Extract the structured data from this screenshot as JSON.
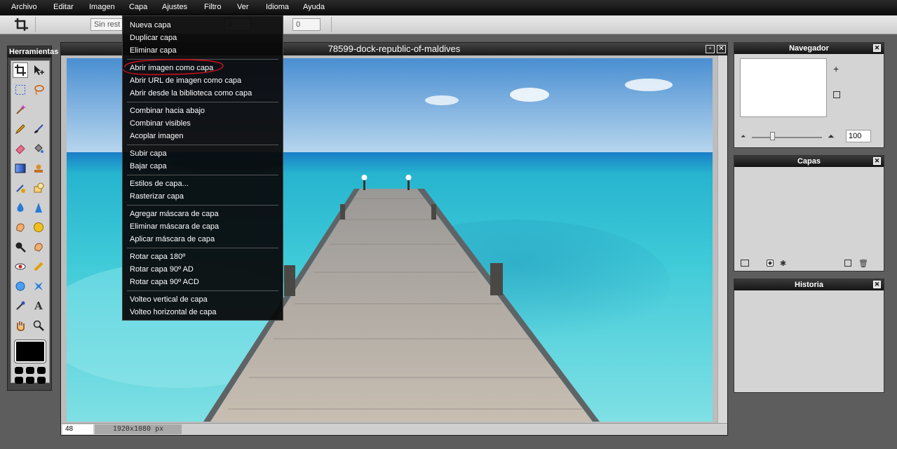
{
  "menubar": {
    "items": [
      "Archivo",
      "Editar",
      "Imagen",
      "Capa",
      "Ajustes",
      "Filtro",
      "Ver",
      "Idioma",
      "Ayuda"
    ]
  },
  "options_bar": {
    "restriction_value": "Sin rest",
    "width_value": "0",
    "height_value": "0"
  },
  "toolbox": {
    "title": "Herramientas"
  },
  "document": {
    "title": "78599-dock-republic-of-maldives",
    "zoom": "48",
    "dimensions": "1920x1080 px"
  },
  "layer_menu": {
    "groups": [
      [
        "Nueva capa",
        "Duplicar capa",
        "Eliminar capa"
      ],
      [
        "Abrir imagen como capa",
        "Abrir URL de imagen como capa",
        "Abrir desde la biblioteca como capa"
      ],
      [
        "Combinar hacia abajo",
        "Combinar visibles",
        "Acoplar imagen"
      ],
      [
        "Subir capa",
        "Bajar capa"
      ],
      [
        "Estilos de capa...",
        "Rasterizar capa"
      ],
      [
        "Agregar máscara de capa",
        "Eliminar máscara de capa",
        "Aplicar máscara de capa"
      ],
      [
        "Rotar capa 180º",
        "Rotar capa 90º AD",
        "Rotar capa 90º ACD"
      ],
      [
        "Volteo vertical de capa",
        "Volteo horizontal de capa"
      ]
    ],
    "highlighted": "Abrir imagen como capa",
    "annotation_color": "#d0101a"
  },
  "navigator": {
    "title": "Navegador",
    "zoom": "100"
  },
  "layers_panel": {
    "title": "Capas"
  },
  "history_panel": {
    "title": "Historia"
  }
}
